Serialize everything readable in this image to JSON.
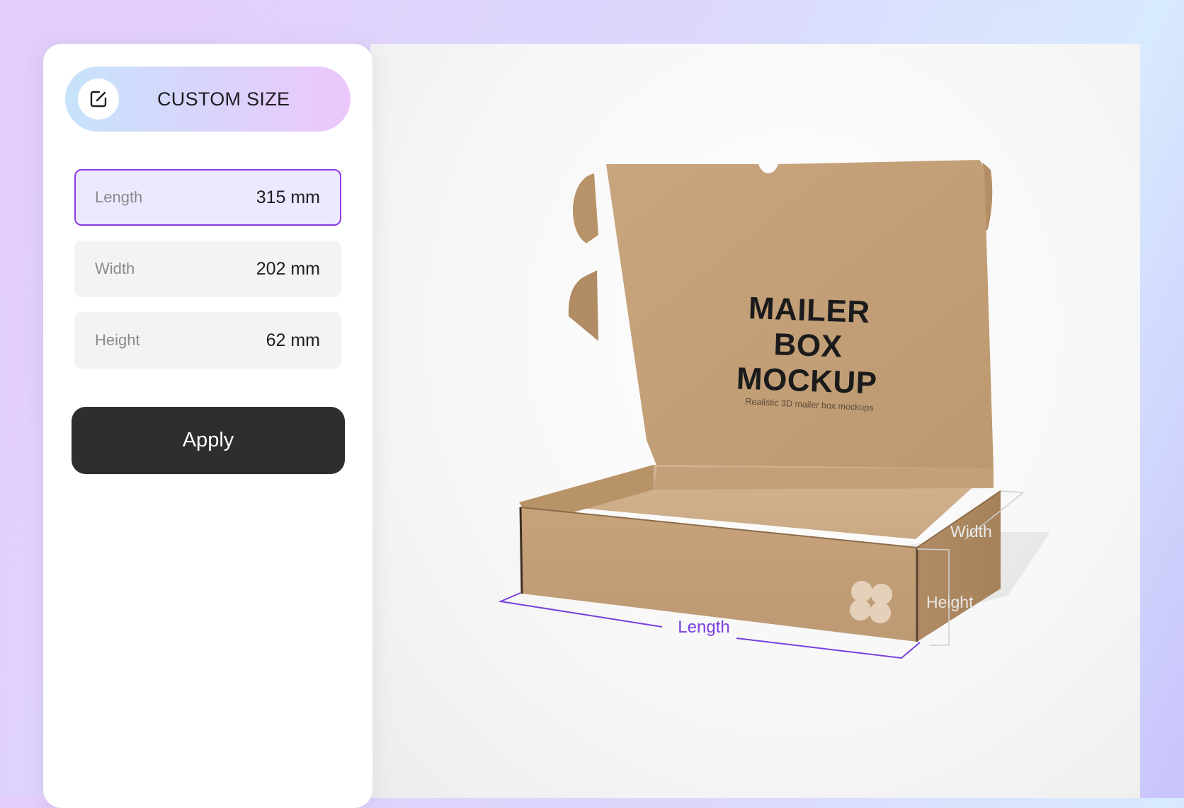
{
  "panel": {
    "header": {
      "title": "CUSTOM SIZE",
      "icon": "edit-icon"
    },
    "fields": [
      {
        "label": "Length",
        "value": "315 mm",
        "active": true
      },
      {
        "label": "Width",
        "value": "202 mm",
        "active": false
      },
      {
        "label": "Height",
        "value": "62 mm",
        "active": false
      }
    ],
    "apply_label": "Apply"
  },
  "preview": {
    "box_title": "MAILER BOX MOCKUP",
    "box_subtitle": "Realistic 3D mailer box mockups",
    "dimension_labels": {
      "length": "Length",
      "width": "Width",
      "height": "Height"
    },
    "logo_icon": "clover-logo-icon"
  },
  "colors": {
    "accent": "#8b3be6",
    "dimension_line": "#7a3fe0",
    "button_dark": "#2e2e2e",
    "kraft": "#c39e77"
  }
}
